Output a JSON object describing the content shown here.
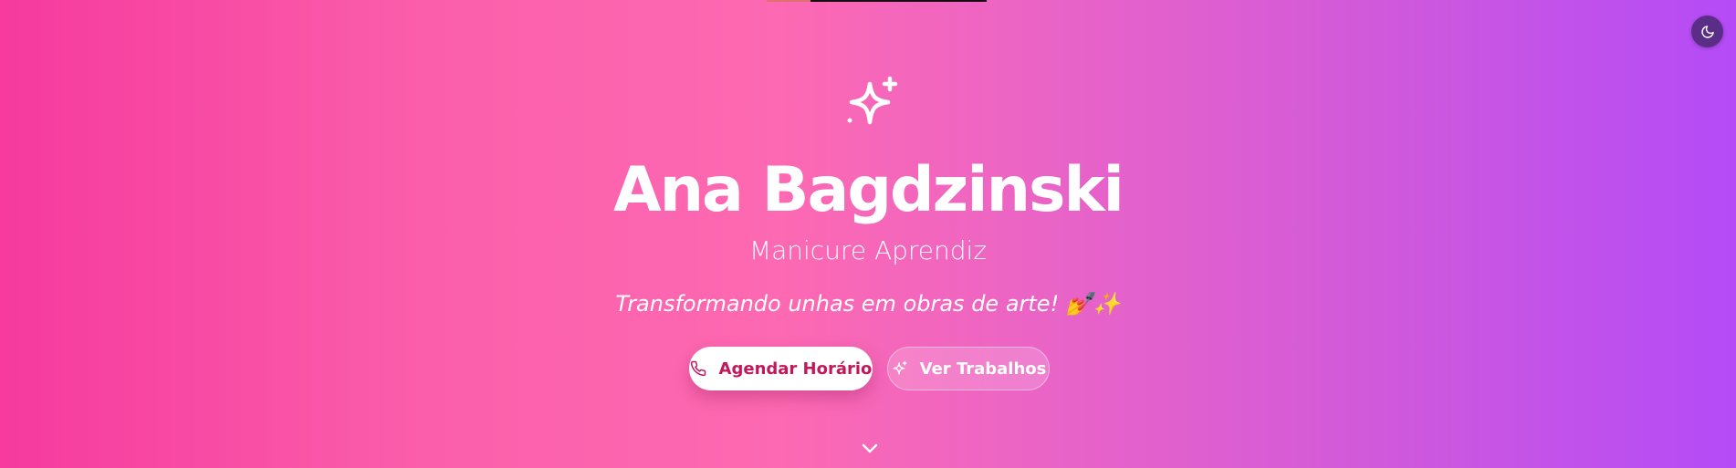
{
  "hero": {
    "name": "Ana Bagdzinski",
    "role": "Manicure Aprendiz",
    "tagline": "Transformando unhas em obras de arte! 💅✨",
    "gradient_colors": [
      "#f63a9e",
      "#fd69b2",
      "#b44bf7"
    ]
  },
  "buttons": {
    "primary_label": "Agendar Horário",
    "primary_icon": "phone-icon",
    "secondary_label": "Ver Trabalhos",
    "secondary_icon": "sparkles-icon"
  },
  "theme_toggle": {
    "icon": "moon-icon",
    "background": "#5a2d86"
  },
  "decorations": {
    "hero_icon": "sparkles-icon",
    "scroll_icon": "chevron-down-icon"
  }
}
